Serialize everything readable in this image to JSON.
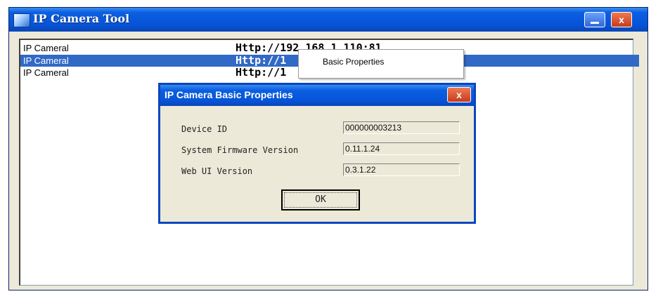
{
  "window": {
    "title": "IP Camera Tool",
    "close_glyph": "x"
  },
  "list": {
    "rows": [
      {
        "name": "IP Cameral",
        "url": "Http://192.168.1.110:81"
      },
      {
        "name": "IP Cameral",
        "url": "Http://1"
      },
      {
        "name": "IP Cameral",
        "url": "Http://1"
      }
    ],
    "selected_index": 1
  },
  "context_menu": {
    "items": [
      "Basic Properties"
    ]
  },
  "dialog": {
    "title": "IP Camera Basic Properties",
    "close_glyph": "x",
    "fields": [
      {
        "label": "Device ID",
        "value": "000000003213"
      },
      {
        "label": "System Firmware Version",
        "value": "0.11.1.24"
      },
      {
        "label": "Web UI Version",
        "value": "0.3.1.22"
      }
    ],
    "ok_label": "OK"
  },
  "colors": {
    "titlebar": "#0654d8",
    "selection": "#3169c6",
    "dialog_bg": "#ece9d8"
  },
  "icons": [
    "app-icon",
    "minimize-icon",
    "close-icon"
  ]
}
